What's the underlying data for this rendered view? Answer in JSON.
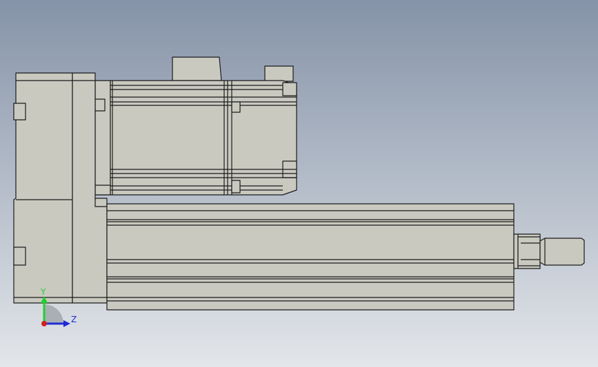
{
  "viewport": {
    "background_top": "#8593a8",
    "background_bottom": "#e3e6ea"
  },
  "model": {
    "body_fill": "#c9c9c0",
    "body_fill_dark": "#b3b3aa",
    "edge_color": "#1a1a1a"
  },
  "triad": {
    "y_label": "Y",
    "z_label": "Z",
    "y_color": "#1fd12a",
    "z_color": "#1f2bd1",
    "x_color": "#d11f1f"
  }
}
